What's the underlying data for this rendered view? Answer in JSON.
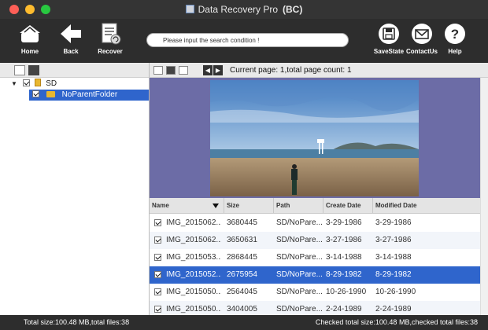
{
  "window": {
    "title": "Data Recovery Pro",
    "title_suffix": "(BC)"
  },
  "colors": {
    "close": "#fe5f57",
    "minimize": "#febc2e",
    "maximize": "#28c840",
    "selection": "#2f65cc"
  },
  "toolbar": {
    "home": {
      "label": "Home",
      "icon": "home-icon"
    },
    "back": {
      "label": "Back",
      "icon": "back-arrow-icon"
    },
    "recover": {
      "label": "Recover",
      "icon": "recover-icon"
    },
    "savestate": {
      "label": "SaveState",
      "icon": "floppy-disk-icon"
    },
    "contactus": {
      "label": "ContactUs",
      "icon": "envelope-icon"
    },
    "help": {
      "label": "Help",
      "icon": "question-icon"
    }
  },
  "search": {
    "placeholder": "Please input the search condition !",
    "value": ""
  },
  "tree": {
    "root": {
      "label": "SD",
      "checked": true,
      "expanded": true
    },
    "child": {
      "label": "NoParentFolder",
      "checked": true,
      "selected": true
    }
  },
  "pager": {
    "info": "Current page: 1,total page count: 1"
  },
  "table": {
    "columns": {
      "name": "Name",
      "size": "Size",
      "path": "Path",
      "create": "Create Date",
      "modified": "Modified Date"
    },
    "rows": [
      {
        "name": "IMG_2015062...",
        "size": "3680445",
        "path": "SD/NoPare...",
        "create": "3-29-1986",
        "modified": "3-29-1986",
        "checked": true
      },
      {
        "name": "IMG_2015062...",
        "size": "3650631",
        "path": "SD/NoPare...",
        "create": "3-27-1986",
        "modified": "3-27-1986",
        "checked": true
      },
      {
        "name": "IMG_2015053...",
        "size": "2868445",
        "path": "SD/NoPare...",
        "create": "3-14-1988",
        "modified": "3-14-1988",
        "checked": true
      },
      {
        "name": "IMG_2015052...",
        "size": "2675954",
        "path": "SD/NoPare...",
        "create": "8-29-1982",
        "modified": "8-29-1982",
        "checked": true,
        "selected": true
      },
      {
        "name": "IMG_2015050...",
        "size": "2564045",
        "path": "SD/NoPare...",
        "create": "10-26-1990",
        "modified": "10-26-1990",
        "checked": true
      },
      {
        "name": "IMG_2015050...",
        "size": "3404005",
        "path": "SD/NoPare...",
        "create": "2-24-1989",
        "modified": "2-24-1989",
        "checked": true
      }
    ]
  },
  "status": {
    "total": "Total size:100.48 MB,total files:38",
    "checked": "Checked total size:100.48 MB,checked total files:38"
  }
}
